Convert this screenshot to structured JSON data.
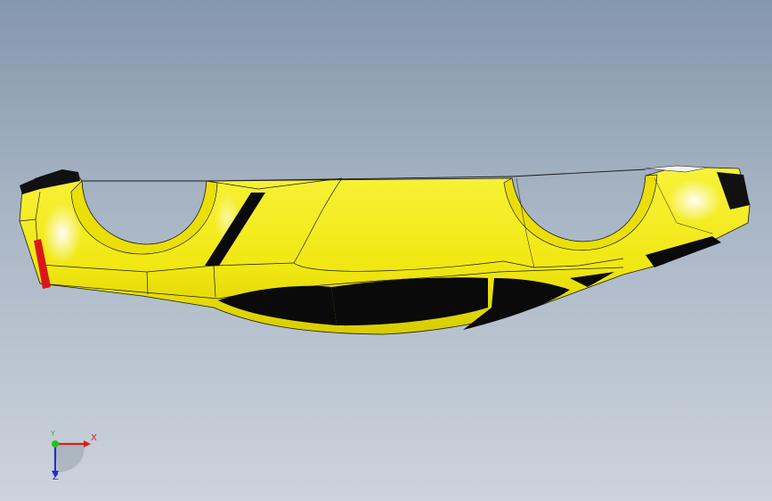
{
  "viewport": {
    "model_color": "#f4ec16",
    "background_top": "#8597ad",
    "background_bottom": "#ccd3dc"
  },
  "triad": {
    "x_label": "X",
    "y_label": "Y",
    "z_label": "Z",
    "x_color": "#d42020",
    "y_color": "#20c020",
    "z_color": "#2030c8"
  }
}
